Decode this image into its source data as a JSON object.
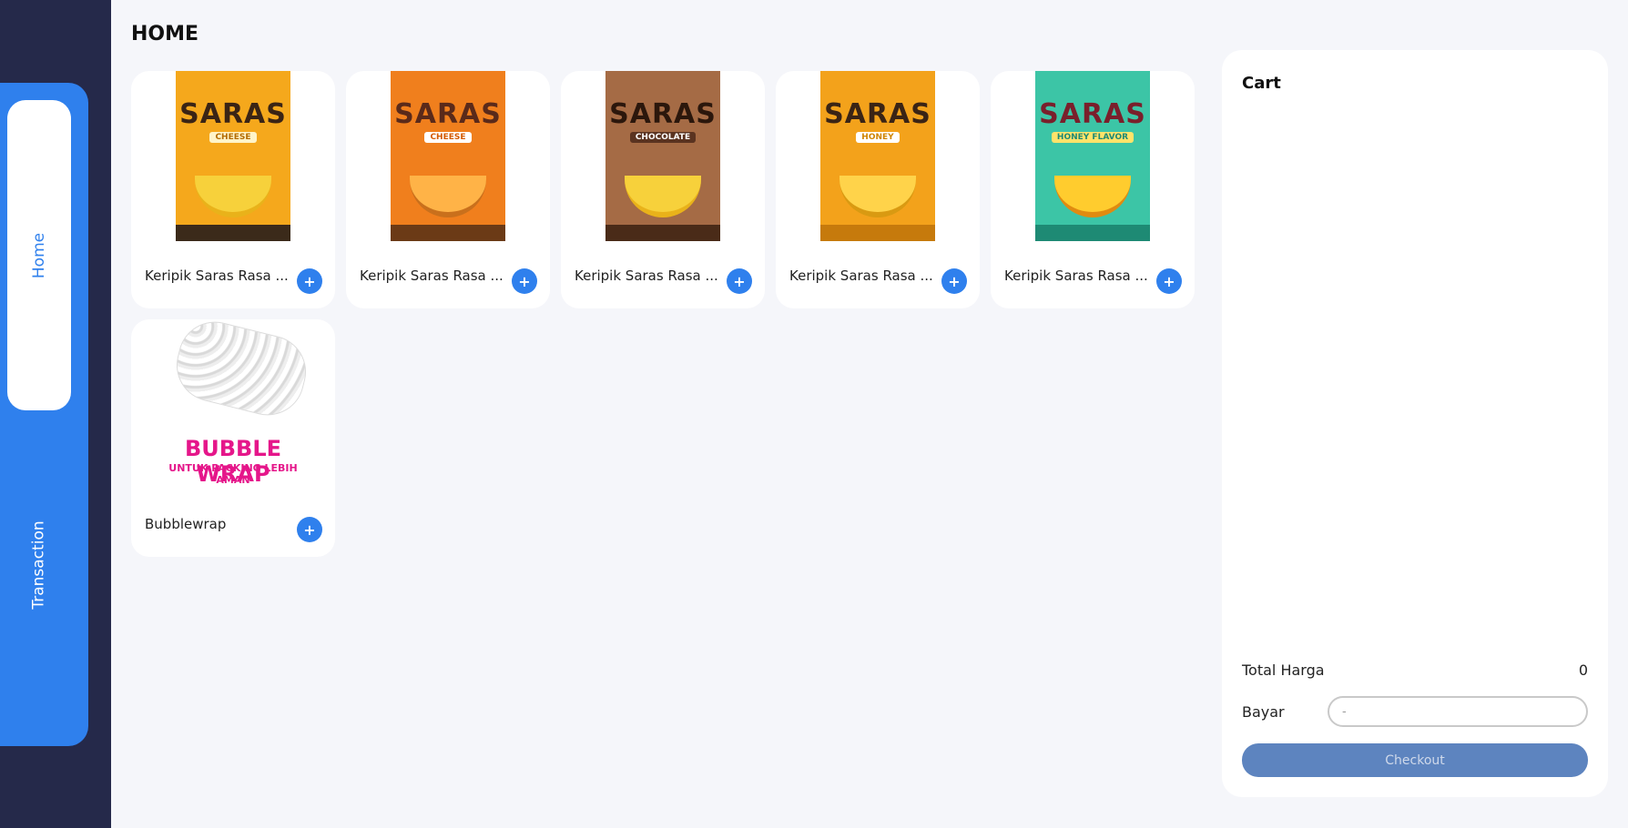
{
  "sidebar": {
    "items": [
      {
        "label": "Home",
        "active": true
      },
      {
        "label": "Transaction",
        "active": false
      }
    ]
  },
  "page": {
    "title": "HOME"
  },
  "products": [
    {
      "name": "Keripik Saras Rasa ...",
      "brand": "SARAS",
      "flavor": "CHEESE",
      "bg": "#f5a81c",
      "strip": "#3b2a1a"
    },
    {
      "name": "Keripik Saras Rasa ...",
      "brand": "SARAS",
      "flavor": "CHEESE",
      "bg": "#f07f1d",
      "strip": "#6b3a16"
    },
    {
      "name": "Keripik Saras Rasa ...",
      "brand": "SARAS",
      "flavor": "CHOCOLATE",
      "bg": "#a56b45",
      "strip": "#4a2b18"
    },
    {
      "name": "Keripik Saras Rasa ...",
      "brand": "SARAS",
      "flavor": "HONEY",
      "bg": "#f3a21b",
      "strip": "#c67a0c"
    },
    {
      "name": "Keripik Saras Rasa ...",
      "brand": "SARAS",
      "flavor": "HONEY FLAVOR",
      "bg": "#3cc5a6",
      "strip": "#1e8a74"
    },
    {
      "name": "Bubblewrap",
      "art_title": "BUBBLE WRAP",
      "art_sub": "UNTUK PACKING LEBIH AMAN"
    }
  ],
  "add_label": "+",
  "cart": {
    "title": "Cart",
    "total_label": "Total Harga",
    "total_value": "0",
    "pay_label": "Bayar",
    "pay_placeholder": "-",
    "checkout_label": "Checkout"
  },
  "colors": {
    "accent": "#2f80ed",
    "sidebar_bg": "#25294a",
    "page_bg": "#f5f6fa",
    "checkout_bg": "#5d84bf",
    "bubble_text": "#e5168a"
  }
}
